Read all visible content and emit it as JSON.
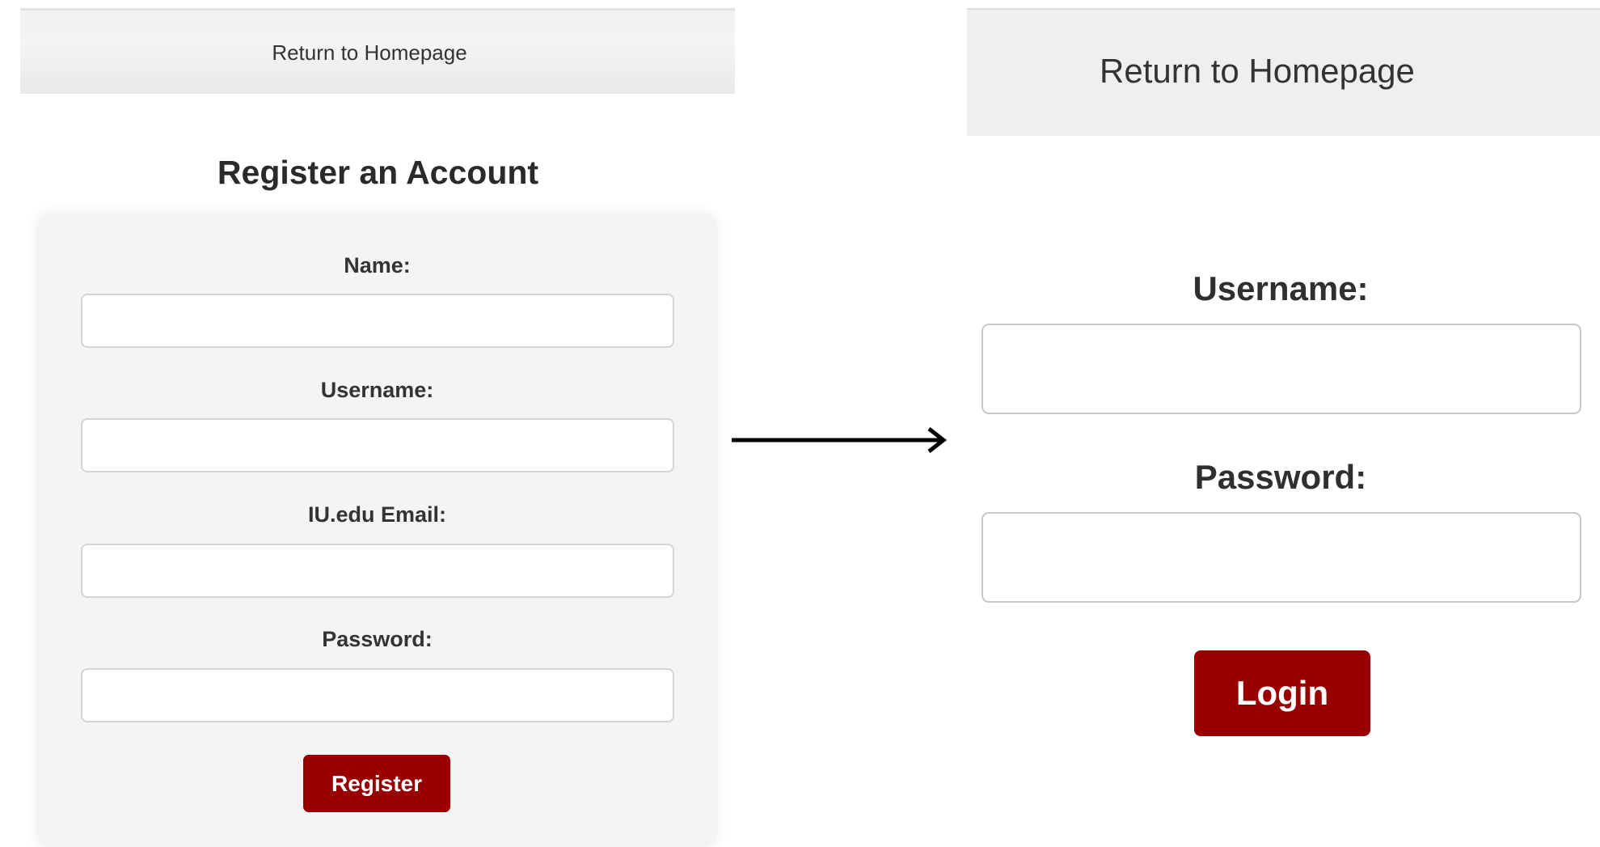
{
  "register_page": {
    "header": {
      "home_link": "Return to Homepage"
    },
    "title": "Register an Account",
    "fields": {
      "name": {
        "label": "Name:",
        "value": ""
      },
      "username": {
        "label": "Username:",
        "value": ""
      },
      "email": {
        "label": "IU.edu Email:",
        "value": ""
      },
      "password": {
        "label": "Password:",
        "value": ""
      }
    },
    "submit_label": "Register"
  },
  "flow_arrow": {
    "icon": "right-arrow-icon",
    "color": "#000000"
  },
  "login_page": {
    "header": {
      "home_link": "Return to Homepage"
    },
    "fields": {
      "username": {
        "label": "Username:",
        "value": ""
      },
      "password": {
        "label": "Password:",
        "value": ""
      }
    },
    "submit_label": "Login"
  },
  "colors": {
    "button_bg": "#990000",
    "button_text": "#ffffff",
    "header_bg": "#efefef",
    "card_bg": "#f4f4f4"
  }
}
